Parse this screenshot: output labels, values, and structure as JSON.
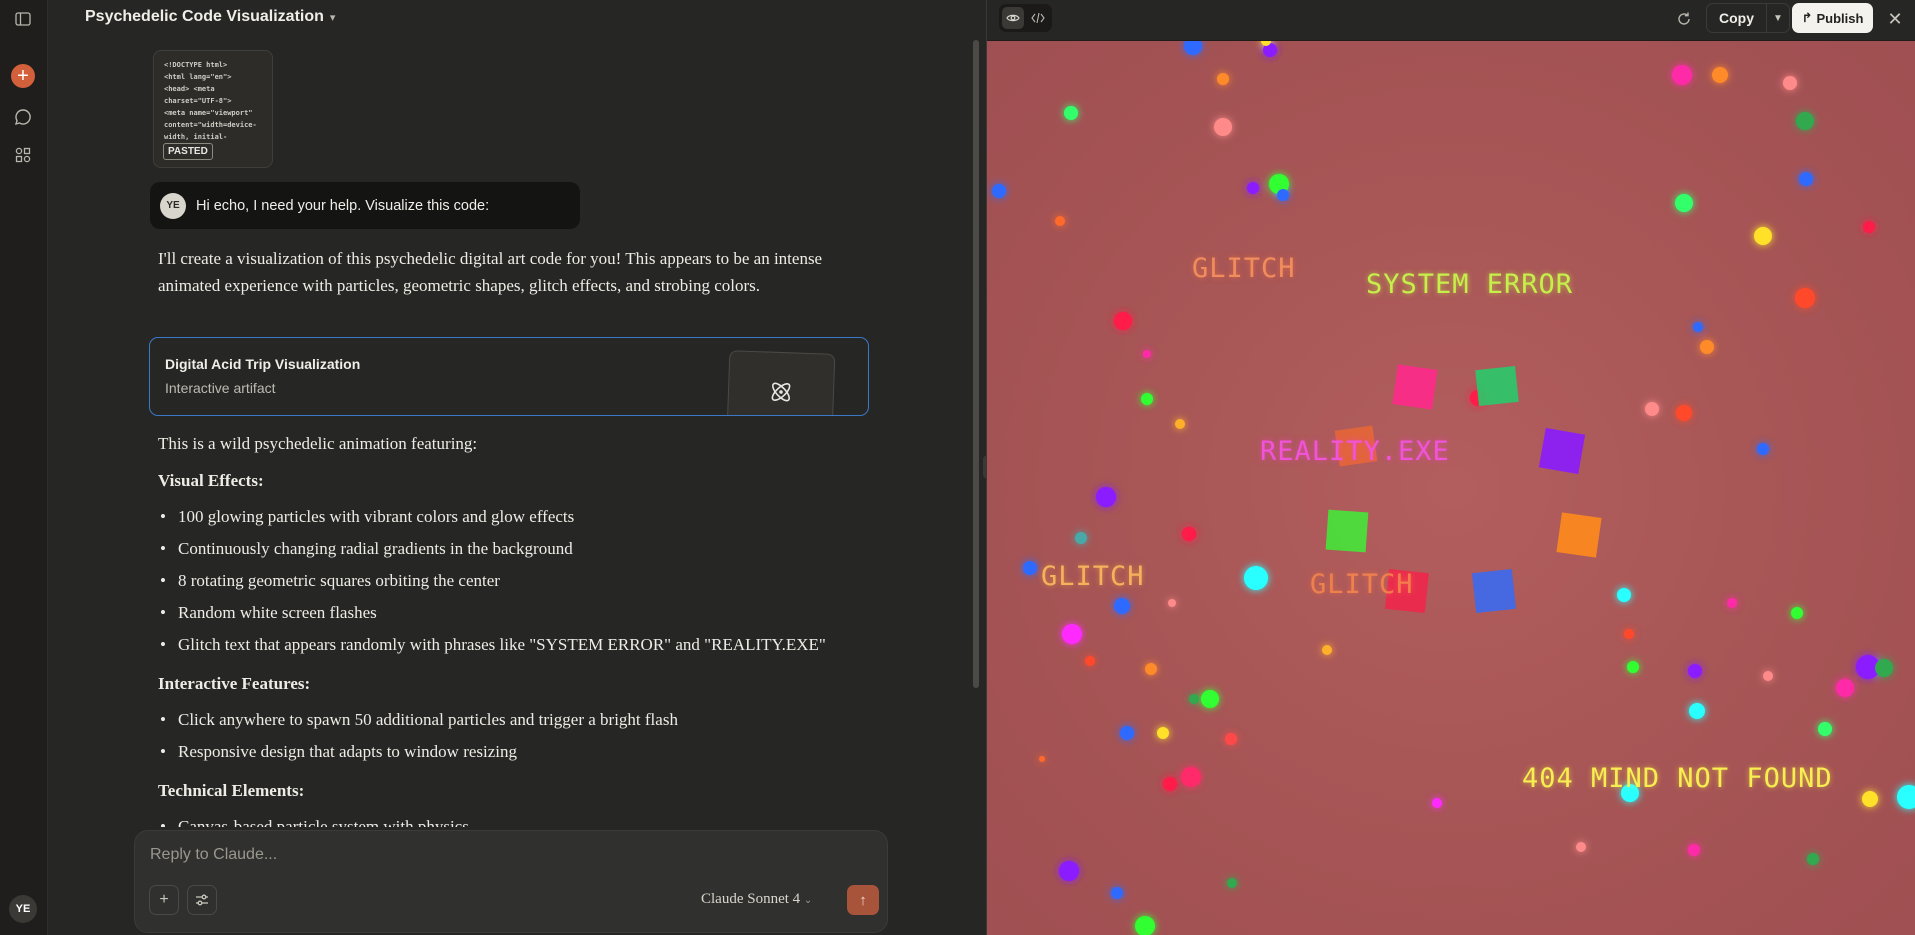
{
  "chat": {
    "title": "Psychedelic Code Visualization",
    "pasted_preview": "<!DOCTYPE html>\n<html lang=\"en\">\n<head> <meta\ncharset=\"UTF-8\">\n<meta name=\"viewport\"\ncontent=\"width=device-\nwidth, initial-",
    "pasted_label": "PASTED",
    "user_initials": "YE",
    "user_message": "Hi echo, I need your help. Visualize this code:",
    "intro": "I'll create a visualization of this psychedelic digital art code for you! This appears to be an intense animated experience with particles, geometric shapes, glitch effects, and strobing colors.",
    "artifact_card": {
      "title": "Digital Acid Trip Visualization",
      "subtitle": "Interactive artifact"
    },
    "lead": "This is a wild psychedelic animation featuring:",
    "sections": [
      {
        "heading": "Visual Effects:",
        "items": [
          "100 glowing particles with vibrant colors and glow effects",
          "Continuously changing radial gradients in the background",
          "8 rotating geometric squares orbiting the center",
          "Random white screen flashes",
          "Glitch text that appears randomly with phrases like \"SYSTEM ERROR\" and \"REALITY.EXE\""
        ]
      },
      {
        "heading": "Interactive Features:",
        "items": [
          "Click anywhere to spawn 50 additional particles and trigger a bright flash",
          "Responsive design that adapts to window resizing"
        ]
      },
      {
        "heading": "Technical Elements:",
        "items": [
          "Canvas-based particle system with physics"
        ]
      }
    ]
  },
  "composer": {
    "placeholder": "Reply to Claude...",
    "model": "Claude Sonnet 4"
  },
  "artifact_toolbar": {
    "copy_label": "Copy",
    "publish_label": "Publish"
  },
  "canvas": {
    "glitch_texts": [
      "GLITCH",
      "SYSTEM ERROR",
      "REALITY.EXE",
      "GLITCH",
      "GLITCH",
      "404 MIND NOT FOUND"
    ]
  },
  "sidebar": {
    "user_initials": "YE"
  },
  "colors": {
    "accent": "#d2603a",
    "artifact_border": "#3b78c8",
    "canvas_bg": "#a85656"
  }
}
